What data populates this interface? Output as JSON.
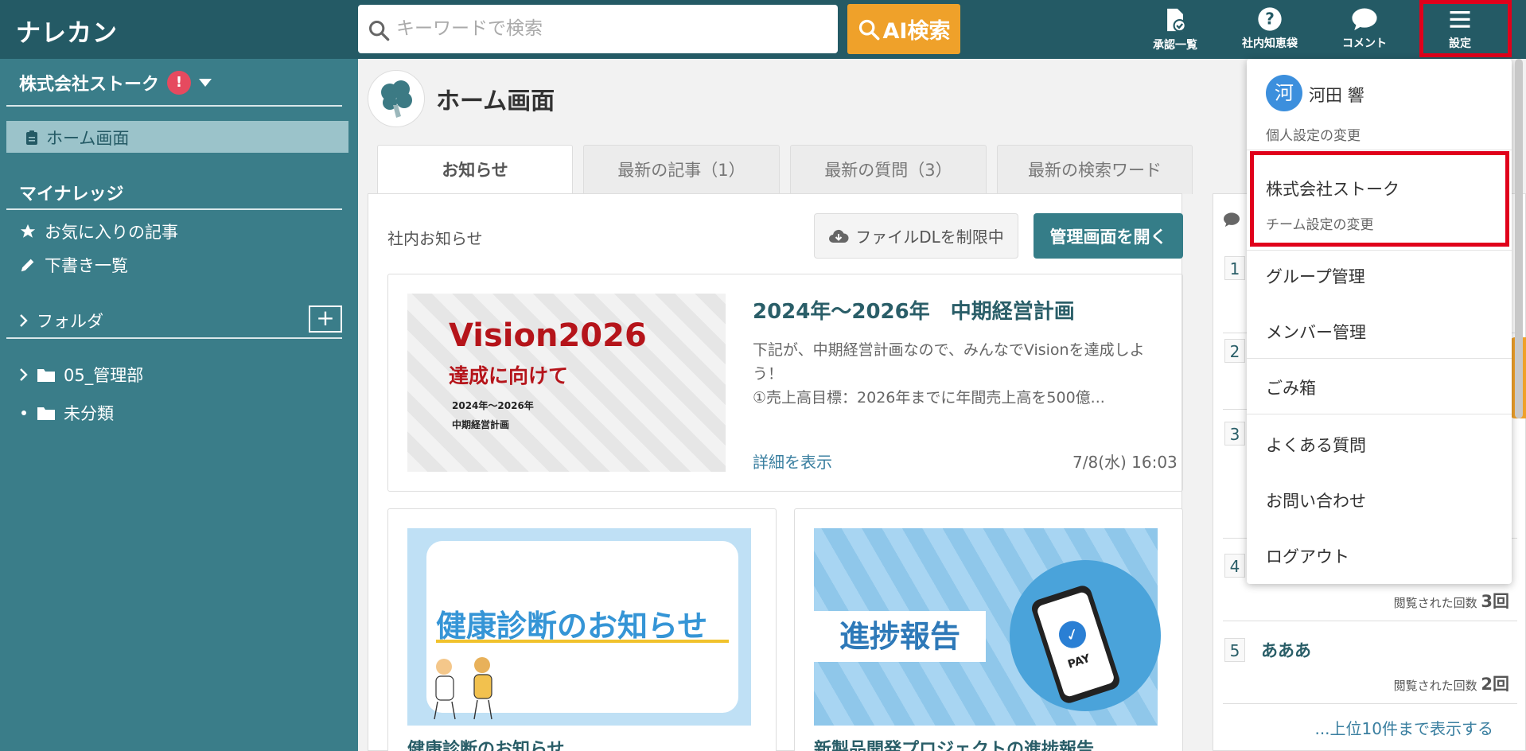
{
  "app": {
    "logo": "ナレカン"
  },
  "search": {
    "placeholder": "キーワードで検索",
    "ai_button": "AI検索"
  },
  "topnav": [
    {
      "label": "承認一覧",
      "icon": "approval-doc-icon"
    },
    {
      "label": "社内知恵袋",
      "icon": "question-circle-icon"
    },
    {
      "label": "コメント",
      "icon": "comment-bubble-icon"
    },
    {
      "label": "設定",
      "icon": "hamburger-menu-icon"
    }
  ],
  "sidebar": {
    "company": "株式会社ストーク",
    "alert": "!",
    "home": "ホーム画面",
    "my_knowledge_head": "マイナレッジ",
    "favorites": "お気に入りの記事",
    "drafts": "下書き一覧",
    "folder_head": "フォルダ",
    "folder_add": "+",
    "folders": [
      "05_管理部",
      "未分類"
    ]
  },
  "main": {
    "title": "ホーム画面",
    "tabs": [
      "お知らせ",
      "最新の記事（1）",
      "最新の質問（3）",
      "最新の検索ワード"
    ],
    "panel_title": "社内お知らせ",
    "dl_button": "ファイルDLを制限中",
    "admin_button": "管理画面を開く",
    "featured": {
      "img_line1": "Vision2026",
      "img_line2": "達成に向けて",
      "img_line3": "2024年〜2026年",
      "img_line4": "中期経営計画",
      "title": "2024年～2026年　中期経営計画",
      "body": "下記が、中期経営計画なので、みんなでVisionを達成しよう！\n①売上高目標：2026年までに年間売上高を500億...",
      "link": "詳細を表示",
      "date": "7/8(水) 16:03"
    },
    "cards": [
      {
        "img_text": "健康診断のお知らせ",
        "caption": "健康診断のお知らせ"
      },
      {
        "img_text": "進捗報告",
        "pay_label": "PAY",
        "caption": "新製品開発プロジェクトの進捗報告"
      }
    ]
  },
  "ranking": {
    "rows": [
      {
        "num": "1",
        "title": "",
        "views_label": "",
        "views": ""
      },
      {
        "num": "2",
        "title": "",
        "views_label": "",
        "views": ""
      },
      {
        "num": "3",
        "title": "",
        "views_label": "",
        "views": ""
      },
      {
        "num": "4",
        "title": "",
        "views_label": "閲覧された回数",
        "views": "3回"
      },
      {
        "num": "5",
        "title": "あああ",
        "views_label": "閲覧された回数",
        "views": "2回"
      }
    ],
    "more": "...上位10件まで表示する"
  },
  "dropdown": {
    "avatar": "河",
    "user": "河田 響",
    "personal_settings": "個人設定の変更",
    "team": "株式会社ストーク",
    "team_settings": "チーム設定の変更",
    "items": [
      "グループ管理",
      "メンバー管理",
      "ごみ箱",
      "よくある質問",
      "お問い合わせ",
      "ログアウト"
    ]
  },
  "colors": {
    "topbar": "#245a65",
    "sidebar": "#3a7d89",
    "accent_orange": "#efa12a",
    "highlight_red": "#e0001b",
    "admin_button": "#357d88"
  }
}
